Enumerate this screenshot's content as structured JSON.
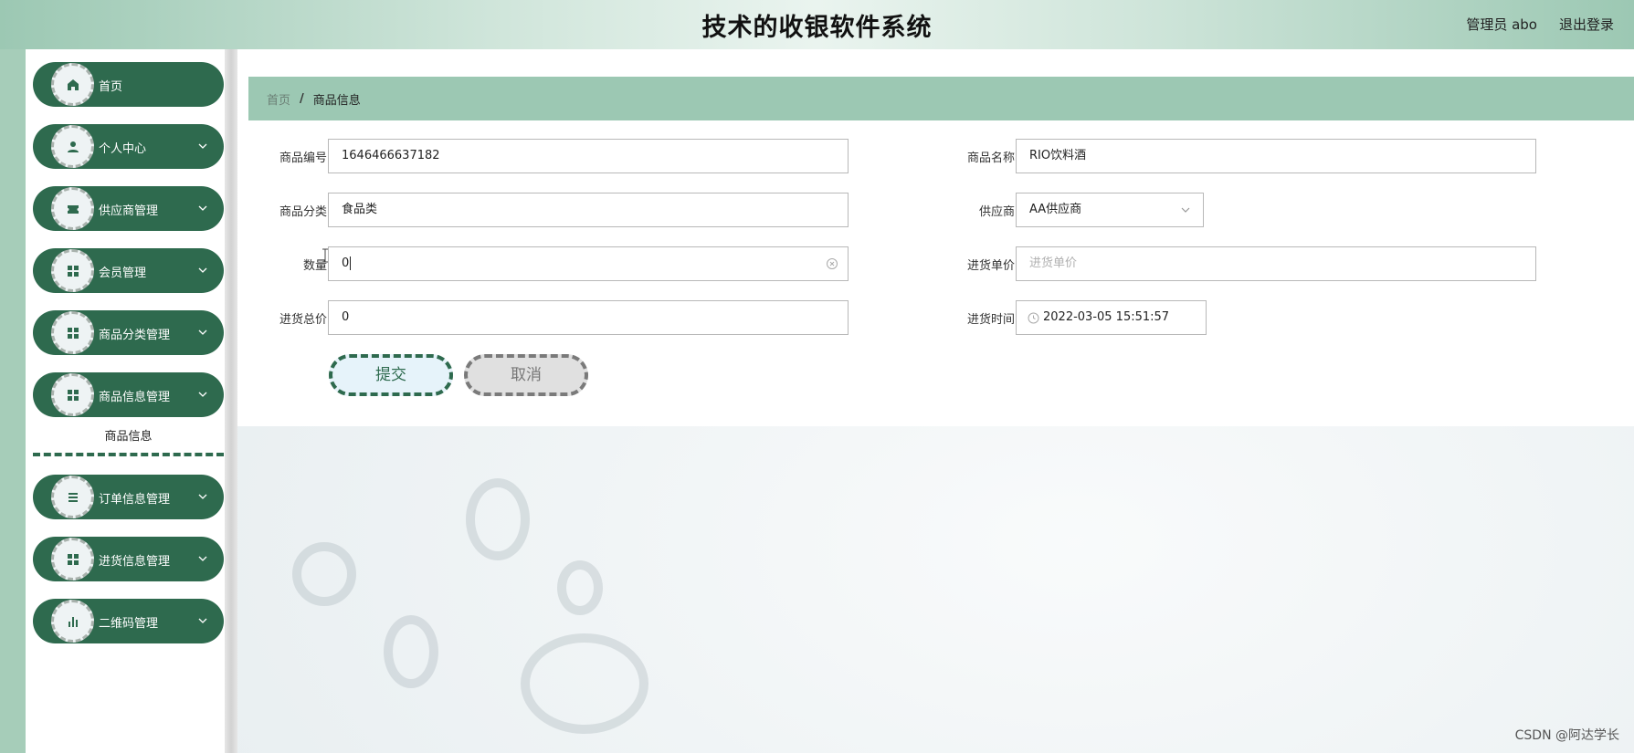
{
  "header": {
    "title": "技术的收银软件系统",
    "user": "管理员 abo",
    "logout": "退出登录"
  },
  "sidebar": {
    "items": [
      {
        "label": "首页",
        "icon": "home-icon",
        "has_children": false
      },
      {
        "label": "个人中心",
        "icon": "user-icon",
        "has_children": true
      },
      {
        "label": "供应商管理",
        "icon": "ticket-icon",
        "has_children": true
      },
      {
        "label": "会员管理",
        "icon": "grid-icon",
        "has_children": true
      },
      {
        "label": "商品分类管理",
        "icon": "grid-icon",
        "has_children": true
      },
      {
        "label": "商品信息管理",
        "icon": "grid-icon",
        "has_children": true
      },
      {
        "label": "订单信息管理",
        "icon": "list-icon",
        "has_children": true
      },
      {
        "label": "进货信息管理",
        "icon": "grid-icon",
        "has_children": true
      },
      {
        "label": "二维码管理",
        "icon": "bar-chart-icon",
        "has_children": true
      }
    ],
    "subitem": {
      "label": "商品信息",
      "parent": "商品信息管理"
    }
  },
  "breadcrumb": {
    "home": "首页",
    "separator": "/",
    "current": "商品信息"
  },
  "form": {
    "product_code": {
      "label": "商品编号",
      "value": "1646466637182"
    },
    "product_name": {
      "label": "商品名称",
      "value": "RIO饮料酒"
    },
    "category": {
      "label": "商品分类",
      "value": "食品类"
    },
    "supplier": {
      "label": "供应商",
      "value": "AA供应商"
    },
    "quantity": {
      "label": "数量",
      "value": "0"
    },
    "unit_price": {
      "label": "进货单价",
      "placeholder": "进货单价"
    },
    "total_price": {
      "label": "进货总价",
      "value": "0"
    },
    "purchase_time": {
      "label": "进货时间",
      "value": "2022-03-05 15:51:57"
    },
    "submit_label": "提交",
    "cancel_label": "取消"
  },
  "watermark": "CSDN @阿达学长",
  "colors": {
    "primary": "#2e6a4e",
    "accent_light": "#9cc8b3",
    "sidebar_strip": "#a6cdb9"
  }
}
